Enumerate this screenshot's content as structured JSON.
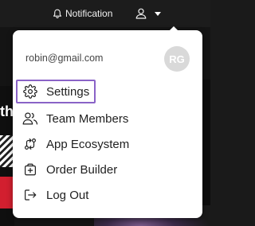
{
  "topbar": {
    "notification_label": "Notification",
    "bell_icon": "bell-icon",
    "user_icon": "user-icon",
    "caret_icon": "caret-down-icon"
  },
  "background": {
    "left_partial_text": "th"
  },
  "dropdown": {
    "email": "robin@gmail.com",
    "avatar_initials": "RG",
    "items": [
      {
        "label": "Settings",
        "icon": "gear-icon",
        "active": true
      },
      {
        "label": "Team Members",
        "icon": "team-icon"
      },
      {
        "label": "App Ecosystem",
        "icon": "ecosystem-icon"
      },
      {
        "label": "Order Builder",
        "icon": "order-builder-icon"
      },
      {
        "label": "Log Out",
        "icon": "logout-icon"
      }
    ],
    "highlight_color": "#8a63c7"
  }
}
